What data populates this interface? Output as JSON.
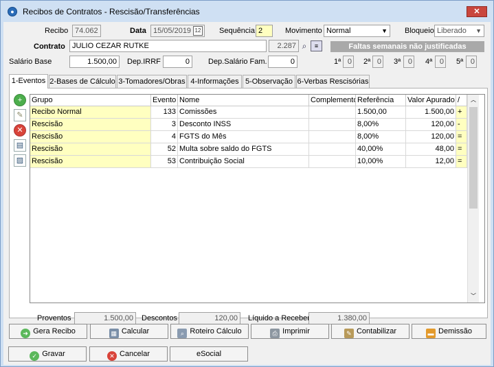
{
  "window": {
    "title": "Recibos de Contratos - Rescisão/Transferências",
    "close": "✕"
  },
  "header": {
    "recibo_label": "Recibo",
    "recibo_value": "74.062",
    "data_label": "Data",
    "data_value": "15/05/2019",
    "sequencia_label": "Sequência",
    "sequencia_value": "2",
    "movimento_label": "Movimento",
    "movimento_value": "Normal",
    "bloqueio_label": "Bloqueio",
    "bloqueio_value": "Liberado",
    "contrato_label": "Contrato",
    "contrato_value": "JULIO CEZAR RUTKE",
    "contrato_code": "2.287",
    "banner": "Faltas semanais não justificadas",
    "salario_label": "Salário Base",
    "salario_value": "1.500,00",
    "dep_irrf_label": "Dep.IRRF",
    "dep_irrf_value": "0",
    "dep_salario_label": "Dep.Salário Fam.",
    "dep_salario_value": "0",
    "weeks": [
      {
        "label": "1ª",
        "value": "0"
      },
      {
        "label": "2ª",
        "value": "0"
      },
      {
        "label": "3ª",
        "value": "0"
      },
      {
        "label": "4ª",
        "value": "0"
      },
      {
        "label": "5ª",
        "value": "0"
      }
    ]
  },
  "tabs": [
    "1-Eventos",
    "2-Bases de Cálculo",
    "3-Tomadores/Obras",
    "4-Informações",
    "5-Observação",
    "6-Verbas Rescisórias"
  ],
  "grid": {
    "columns": [
      "Grupo",
      "Evento",
      "Nome",
      "Complemento",
      "Referência",
      "Valor Apurado",
      "/"
    ],
    "rows": [
      {
        "grupo": "Recibo Normal",
        "evento": "133",
        "nome": "Comissões",
        "complemento": "",
        "referencia": "1.500,00",
        "valor": "1.500,00",
        "sinal": "+"
      },
      {
        "grupo": "Rescisão",
        "evento": "3",
        "nome": "Desconto INSS",
        "complemento": "",
        "referencia": "8,00%",
        "valor": "120,00",
        "sinal": "-"
      },
      {
        "grupo": "Rescisão",
        "evento": "4",
        "nome": "FGTS do Mês",
        "complemento": "",
        "referencia": "8,00%",
        "valor": "120,00",
        "sinal": "="
      },
      {
        "grupo": "Rescisão",
        "evento": "52",
        "nome": "Multa sobre saldo do FGTS",
        "complemento": "",
        "referencia": "40,00%",
        "valor": "48,00",
        "sinal": "="
      },
      {
        "grupo": "Rescisão",
        "evento": "53",
        "nome": "Contribuição Social",
        "complemento": "",
        "referencia": "10,00%",
        "valor": "12,00",
        "sinal": "="
      }
    ]
  },
  "totals": {
    "proventos_label": "Proventos",
    "proventos_value": "1.500,00",
    "descontos_label": "Descontos",
    "descontos_value": "120,00",
    "liquido_label": "Líquido a Receber",
    "liquido_value": "1.380,00"
  },
  "buttons": {
    "gera_recibo": "Gera Recibo",
    "calcular": "Calcular",
    "roteiro": "Roteiro Cálculo",
    "imprimir": "Imprimir",
    "contabilizar": "Contabilizar",
    "demissao": "Demissão",
    "gravar": "Gravar",
    "cancelar": "Cancelar",
    "esocial": "eSocial"
  }
}
